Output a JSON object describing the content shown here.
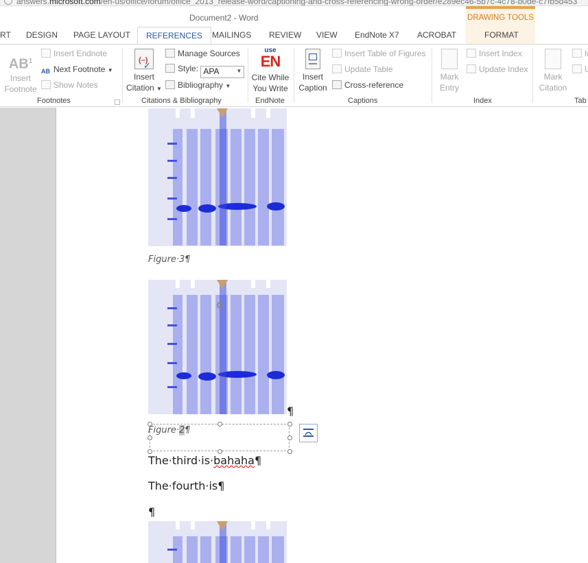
{
  "browser": {
    "url_prefix": "answers.",
    "url_domain": "microsoft.com",
    "url_rest": "/en-us/office/forum/office_2013_release-word/captioning-and-cross-referencing-wrong-order/e289ec46-5b7c-4c78-b0de-c7fb5d453"
  },
  "window": {
    "title": "Document2 - Word",
    "contextual_title": "DRAWING TOOLS"
  },
  "tabs": [
    {
      "label": "RT"
    },
    {
      "label": "DESIGN"
    },
    {
      "label": "PAGE LAYOUT"
    },
    {
      "label": "REFERENCES"
    },
    {
      "label": "MAILINGS"
    },
    {
      "label": "REVIEW"
    },
    {
      "label": "VIEW"
    },
    {
      "label": "EndNote X7"
    },
    {
      "label": "ACROBAT"
    },
    {
      "label": "FORMAT"
    }
  ],
  "ribbon": {
    "footnotes": {
      "insert_footnote_line1": "Insert",
      "insert_footnote_line2": "Footnote",
      "insert_endnote": "Insert Endnote",
      "next_footnote": "Next Footnote",
      "show_notes": "Show Notes",
      "group_label": "Footnotes",
      "ab_icon_text": "AB",
      "ab_sup": "1"
    },
    "citations": {
      "insert_citation_line1": "Insert",
      "insert_citation_line2": "Citation",
      "manage_sources": "Manage Sources",
      "style_label": "Style:",
      "style_value": "APA",
      "bibliography": "Bibliography",
      "group_label": "Citations & Bibliography"
    },
    "endnote": {
      "logo_top": "use",
      "logo_main": "EN",
      "cite_line1": "Cite While",
      "cite_line2": "You Write",
      "group_label": "EndNote"
    },
    "captions": {
      "insert_caption_line1": "Insert",
      "insert_caption_line2": "Caption",
      "insert_table_of_figures": "Insert Table of Figures",
      "update_table": "Update Table",
      "cross_reference": "Cross-reference",
      "group_label": "Captions"
    },
    "index": {
      "mark_entry_line1": "Mark",
      "mark_entry_line2": "Entry",
      "insert_index": "Insert Index",
      "update_index": "Update Index",
      "group_label": "Index"
    },
    "toa": {
      "mark_citation_line1": "Mark",
      "mark_citation_line2": "Citation",
      "insert_partial": "In",
      "update_partial": "U",
      "group_label": "Tab"
    }
  },
  "document": {
    "caption1": "Figure·3¶",
    "caption2_prefix": "Figure·",
    "caption2_number": "2",
    "caption2_suffix": "¶",
    "para1_prefix": "The·third·is·",
    "para1_misspelled": "bahaha",
    "para1_suffix": "¶",
    "para2": "The·fourth·is¶",
    "para3": "¶",
    "image_pilcrow": "¶"
  }
}
